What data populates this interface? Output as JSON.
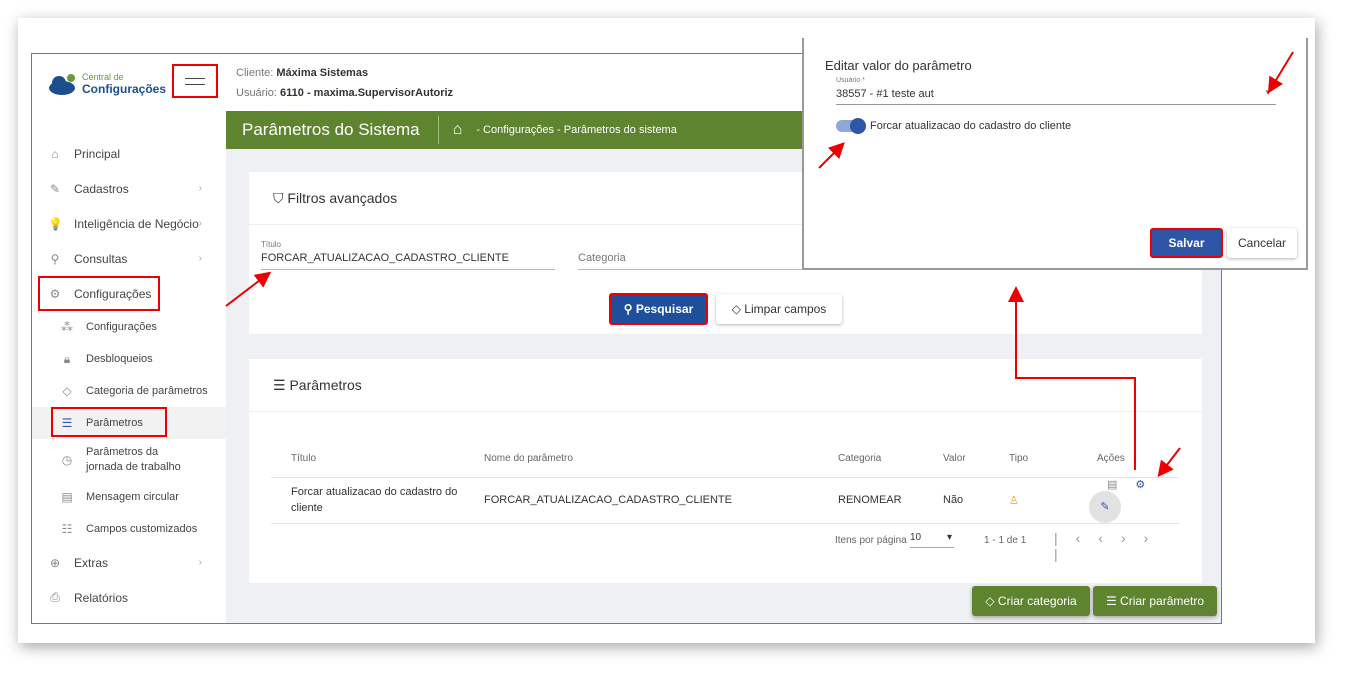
{
  "logo": {
    "line1": "Central de",
    "line2": "Configurações"
  },
  "header": {
    "client_label": "Cliente:",
    "client": "Máxima Sistemas",
    "user_label": "Usuário:",
    "user": "6110 - maxima.SupervisorAutoriz"
  },
  "page": {
    "title": "Parâmetros do Sistema",
    "breadcrumb": "- Configurações - Parâmetros do sistema"
  },
  "sidebar": {
    "items": [
      {
        "label": "Principal",
        "icon": "home-icon"
      },
      {
        "label": "Cadastros",
        "icon": "edit-icon"
      },
      {
        "label": "Inteligência de Negócio",
        "icon": "bulb-icon"
      },
      {
        "label": "Consultas",
        "icon": "search-icon"
      },
      {
        "label": "Configurações",
        "icon": "gear-icon"
      },
      {
        "label": "Extras",
        "icon": "plus-circle-icon"
      },
      {
        "label": "Relatórios",
        "icon": "printer-icon"
      }
    ],
    "sub_items": [
      {
        "label": "Configurações"
      },
      {
        "label": "Desbloqueios"
      },
      {
        "label": "Categoria de parâmetros"
      },
      {
        "label": "Parâmetros"
      },
      {
        "label": "Parâmetros da jornada de trabalho"
      },
      {
        "label": "Mensagem circular"
      },
      {
        "label": "Campos customizados"
      }
    ]
  },
  "filters": {
    "title": "Filtros avançados",
    "titulo_label": "Título",
    "titulo_value": "FORCAR_ATUALIZACAO_CADASTRO_CLIENTE",
    "categoria_placeholder": "Categoria",
    "search": "Pesquisar",
    "clear": "Limpar campos"
  },
  "params": {
    "title": "Parâmetros",
    "columns": [
      "Título",
      "Nome do parâmetro",
      "Categoria",
      "Valor",
      "Tipo",
      "Ações"
    ],
    "rows": [
      {
        "titulo": "Forcar atualizacao do cadastro do cliente",
        "nome": "FORCAR_ATUALIZACAO_CADASTRO_CLIENTE",
        "categoria": "RENOMEAR",
        "valor": "Não"
      }
    ],
    "per_page_label": "Itens por página",
    "per_page": "10",
    "range": "1 - 1 de 1"
  },
  "buttons": {
    "create_category": "Criar categoria",
    "create_param": "Criar parâmetro"
  },
  "dialog": {
    "title": "Editar valor do parâmetro",
    "user_label": "Usuário *",
    "user_value": "38557 - #1 teste aut",
    "toggle_label": "Forcar atualizacao do cadastro do cliente",
    "toggle_on": true,
    "save": "Salvar",
    "cancel": "Cancelar"
  },
  "colors": {
    "green": "#5f8430",
    "blue": "#2f56a6",
    "annotation": "#e00000"
  }
}
